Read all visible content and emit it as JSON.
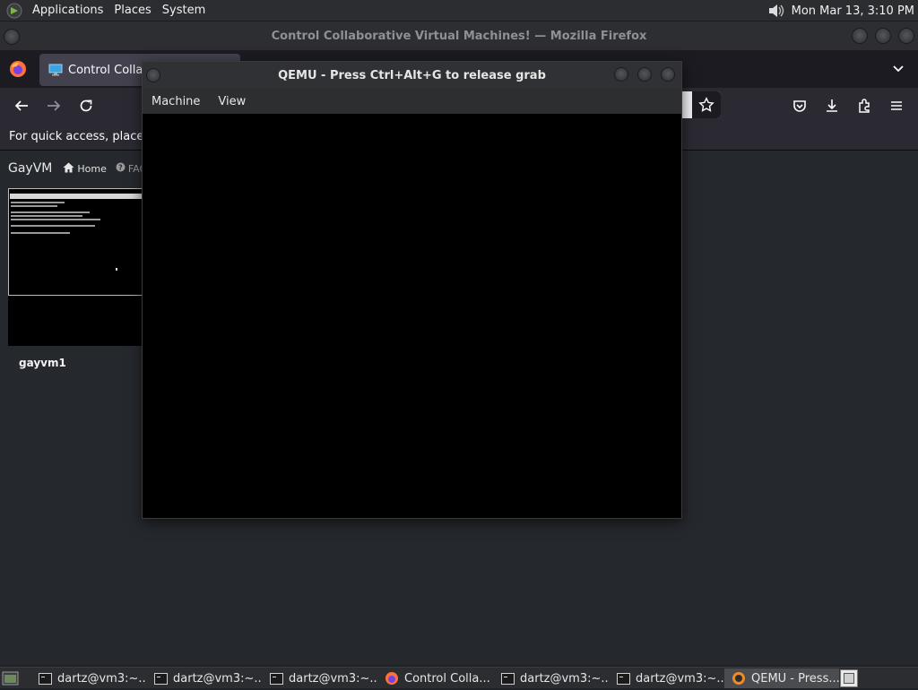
{
  "top_panel": {
    "menus": [
      "Applications",
      "Places",
      "System"
    ],
    "clock": "Mon Mar 13,  3:10 PM"
  },
  "firefox": {
    "window_title": "Control Collaborative Virtual Machines! — Mozilla Firefox",
    "tab_title": "Control Collab",
    "bookmarks_hint": "For quick access, place yo"
  },
  "page": {
    "brand": "GayVM",
    "nav": [
      "Home",
      "FAQ"
    ],
    "vm_name": "gayvm1"
  },
  "qemu": {
    "title": "QEMU - Press Ctrl+Alt+G to release grab",
    "menus": [
      "Machine",
      "View"
    ]
  },
  "taskbar": {
    "items": [
      {
        "label": "dartz@vm3:~...",
        "icon": "terminal-icon"
      },
      {
        "label": "dartz@vm3:~...",
        "icon": "terminal-icon"
      },
      {
        "label": "dartz@vm3:~...",
        "icon": "terminal-icon"
      },
      {
        "label": "Control Colla...",
        "icon": "firefox-icon"
      },
      {
        "label": "dartz@vm3:~...",
        "icon": "terminal-icon"
      },
      {
        "label": "dartz@vm3:~...",
        "icon": "terminal-icon"
      },
      {
        "label": "QEMU - Press...",
        "icon": "qemu-icon"
      }
    ]
  },
  "colors": {
    "panel": "#2b2d30",
    "page_bg": "#25282d",
    "firefox_toolbar": "#2b2a33",
    "qemu_display": "#000000"
  }
}
